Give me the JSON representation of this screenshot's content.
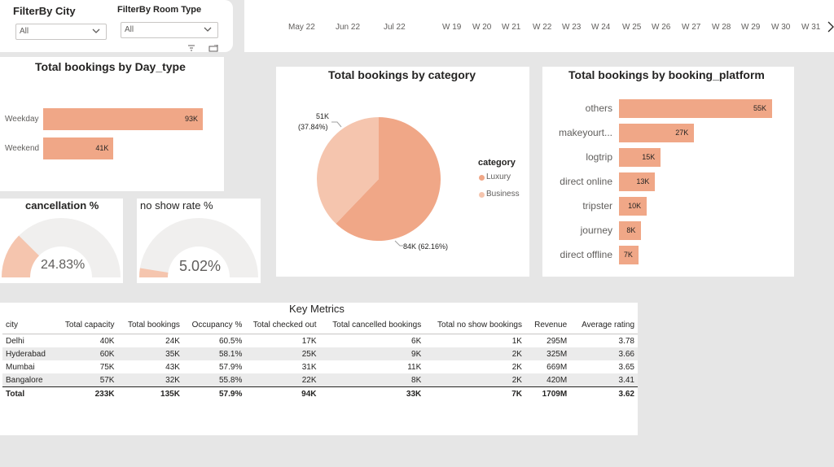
{
  "filters": {
    "city": {
      "label": "FilterBy City",
      "value": "All"
    },
    "room_type": {
      "label": "FilterBy Room Type",
      "value": "All"
    }
  },
  "timeline": {
    "labels": [
      "May 22",
      "Jun 22",
      "Jul 22",
      "W 19",
      "W 20",
      "W 21",
      "W 22",
      "W 23",
      "W 24",
      "W 25",
      "W 26",
      "W 27",
      "W 28",
      "W 29",
      "W 30",
      "W 31"
    ]
  },
  "day_type": {
    "title": "Total bookings by Day_type",
    "categories": [
      {
        "label": "Weekday",
        "value_label": "93K",
        "value": 93
      },
      {
        "label": "Weekend",
        "value_label": "41K",
        "value": 41
      }
    ]
  },
  "cancellation": {
    "title": "cancellation %",
    "value_label": "24.83%",
    "value": 24.83
  },
  "no_show": {
    "title": "no show rate %",
    "value_label": "5.02%",
    "value": 5.02
  },
  "category": {
    "title": "Total bookings by category",
    "legend_title": "category",
    "slices": [
      {
        "name": "Luxury",
        "value_label": "84K (62.16%)",
        "percent": 62.16,
        "color": "#f0a787"
      },
      {
        "name": "Business",
        "value_label": "51K\n(37.84%)",
        "label_line1": "51K",
        "label_line2": "(37.84%)",
        "percent": 37.84,
        "color": "#f5c5ae"
      }
    ]
  },
  "platform": {
    "title": "Total bookings by booking_platform",
    "items": [
      {
        "label": "others",
        "value_label": "55K",
        "value": 55
      },
      {
        "label": "makeyourt...",
        "value_label": "27K",
        "value": 27
      },
      {
        "label": "logtrip",
        "value_label": "15K",
        "value": 15
      },
      {
        "label": "direct online",
        "value_label": "13K",
        "value": 13
      },
      {
        "label": "tripster",
        "value_label": "10K",
        "value": 10
      },
      {
        "label": "journey",
        "value_label": "8K",
        "value": 8
      },
      {
        "label": "direct offline",
        "value_label": "7K",
        "value": 7
      }
    ]
  },
  "key_metrics": {
    "title": "Key Metrics",
    "columns": [
      "city",
      "Total capacity",
      "Total bookings",
      "Occupancy %",
      "Total checked out",
      "Total cancelled bookings",
      "Total no show bookings",
      "Revenue",
      "Average rating"
    ],
    "rows": [
      [
        "Delhi",
        "40K",
        "24K",
        "60.5%",
        "17K",
        "6K",
        "1K",
        "295M",
        "3.78"
      ],
      [
        "Hyderabad",
        "60K",
        "35K",
        "58.1%",
        "25K",
        "9K",
        "2K",
        "325M",
        "3.66"
      ],
      [
        "Mumbai",
        "75K",
        "43K",
        "57.9%",
        "31K",
        "11K",
        "2K",
        "669M",
        "3.65"
      ],
      [
        "Bangalore",
        "57K",
        "32K",
        "55.8%",
        "22K",
        "8K",
        "2K",
        "420M",
        "3.41"
      ]
    ],
    "total": [
      "Total",
      "233K",
      "135K",
      "57.9%",
      "94K",
      "33K",
      "7K",
      "1709M",
      "3.62"
    ]
  },
  "colors": {
    "accent": "#f0a787",
    "accent_light": "#f5c5ae",
    "gauge_track": "#f0efee"
  }
}
